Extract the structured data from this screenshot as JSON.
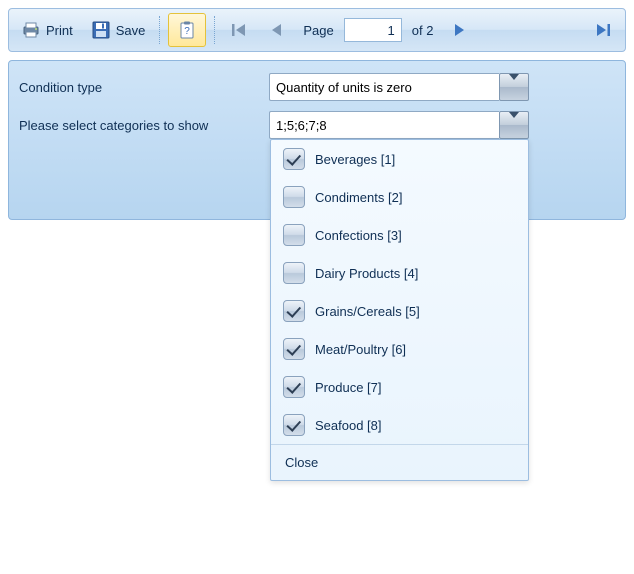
{
  "toolbar": {
    "print_label": "Print",
    "save_label": "Save",
    "page_label": "Page",
    "page_value": "1",
    "page_total": "of 2"
  },
  "form": {
    "condition_label": "Condition type",
    "condition_value": "Quantity of units is zero",
    "categories_label": "Please select categories to show",
    "categories_value": "1;5;6;7;8"
  },
  "dropdown": {
    "items": [
      {
        "label": "Beverages [1]",
        "checked": true
      },
      {
        "label": "Condiments [2]",
        "checked": false
      },
      {
        "label": "Confections [3]",
        "checked": false
      },
      {
        "label": "Dairy Products [4]",
        "checked": false
      },
      {
        "label": "Grains/Cereals [5]",
        "checked": true
      },
      {
        "label": "Meat/Poultry [6]",
        "checked": true
      },
      {
        "label": "Produce [7]",
        "checked": true
      },
      {
        "label": "Seafood [8]",
        "checked": true
      }
    ],
    "close_label": "Close"
  }
}
